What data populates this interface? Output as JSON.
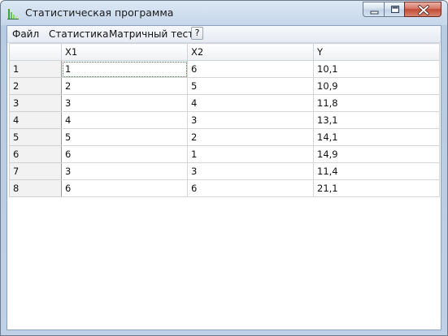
{
  "window": {
    "title": "Статистическая программа"
  },
  "menu": {
    "file": "Файл",
    "statistics": "Статистика",
    "matrix_test": "Матричный тест",
    "help": "?"
  },
  "table": {
    "columns": [
      "X1",
      "X2",
      "Y"
    ],
    "rows": [
      {
        "label": "1",
        "x1": "1",
        "x2": "6",
        "y": "10,1"
      },
      {
        "label": "2",
        "x1": "2",
        "x2": "5",
        "y": "10,9"
      },
      {
        "label": "3",
        "x1": "3",
        "x2": "4",
        "y": "11,8"
      },
      {
        "label": "4",
        "x1": "4",
        "x2": "3",
        "y": "13,1"
      },
      {
        "label": "5",
        "x1": "5",
        "x2": "2",
        "y": "14,1"
      },
      {
        "label": "6",
        "x1": "6",
        "x2": "1",
        "y": "14,9"
      },
      {
        "label": "7",
        "x1": "3",
        "x2": "3",
        "y": "11,4"
      },
      {
        "label": "8",
        "x1": "6",
        "x2": "6",
        "y": "21,1"
      }
    ]
  },
  "icons": {
    "app": "bar-chart-icon",
    "minimize": "minimize-icon",
    "maximize": "maximize-icon",
    "close": "close-icon"
  }
}
